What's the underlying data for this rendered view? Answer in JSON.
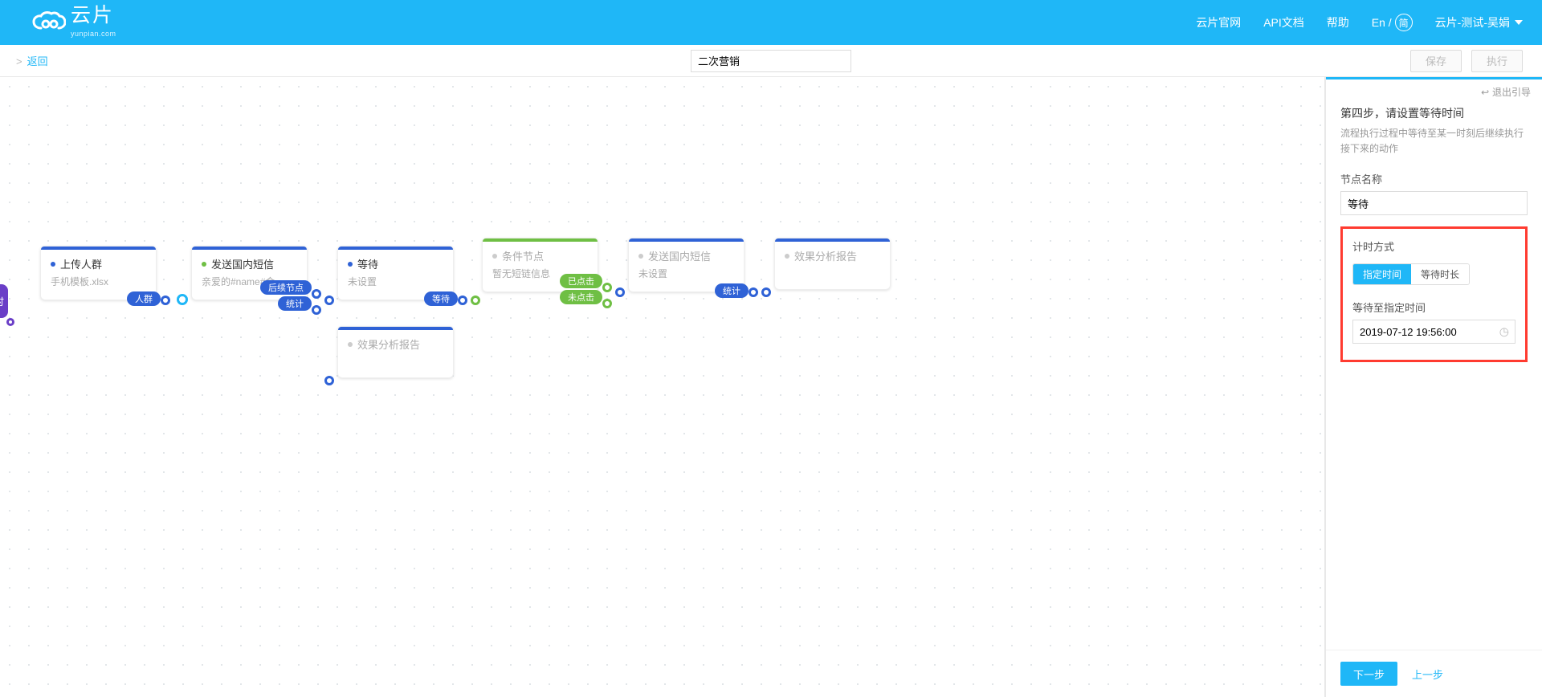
{
  "brand": {
    "name": "云片",
    "sub": "yunpian.com"
  },
  "topnav": {
    "site": "云片官网",
    "api_docs": "API文档",
    "help": "帮助",
    "lang_prefix": "En /",
    "lang_short": "简",
    "user": "云片-测试-吴娟"
  },
  "actionbar": {
    "back": "返回",
    "workflow_name": "二次营销",
    "save": "保存",
    "run": "执行"
  },
  "nodes": {
    "start_half": "时",
    "upload": {
      "title": "上传人群",
      "subtitle": "手机模板.xlsx",
      "pill": "人群",
      "color": "#2f62d6"
    },
    "send1": {
      "title": "发送国内短信",
      "subtitle": "亲爱的#name#会...",
      "pill1": "后续节点",
      "pill2": "统计",
      "color": "#2f62d6"
    },
    "wait": {
      "title": "等待",
      "subtitle": "未设置",
      "pill": "等待",
      "color": "#2f62d6"
    },
    "effect1": {
      "title": "效果分析报告",
      "color": "#2f62d6"
    },
    "cond": {
      "title": "条件节点",
      "subtitle": "暂无短链信息",
      "pill_yes": "已点击",
      "pill_no": "未点击",
      "color": "#6fbf44"
    },
    "send2": {
      "title": "发送国内短信",
      "subtitle": "未设置",
      "pill": "统计",
      "color": "#2f62d6"
    },
    "effect2": {
      "title": "效果分析报告",
      "color": "#2f62d6"
    }
  },
  "panel": {
    "exit_guide": "退出引导",
    "step_title": "第四步，请设置等待时间",
    "step_desc": "流程执行过程中等待至某一时刻后继续执行接下来的动作",
    "name_label": "节点名称",
    "name_value": "等待",
    "mode_label": "计时方式",
    "mode_opt1": "指定时间",
    "mode_opt2": "等待时长",
    "until_label": "等待至指定时间",
    "until_value": "2019-07-12 19:56:00",
    "next": "下一步",
    "prev": "上一步"
  }
}
